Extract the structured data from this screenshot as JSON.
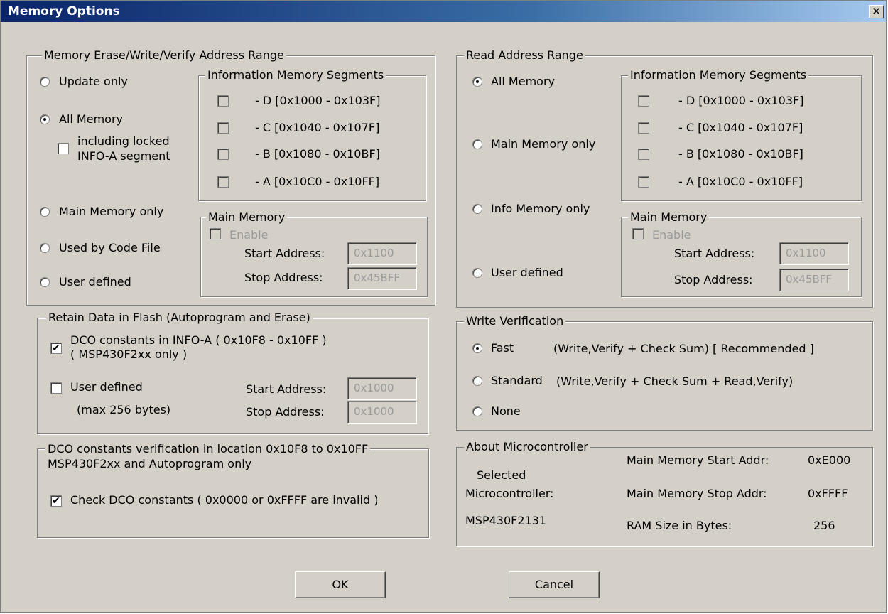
{
  "window": {
    "title": "Memory Options",
    "close_glyph": "✕"
  },
  "erase_range": {
    "legend": "Memory Erase/Write/Verify Address Range",
    "update_only": "Update only",
    "all_memory": "All Memory",
    "locked_line1": "including locked",
    "locked_line2": "INFO-A segment",
    "main_only": "Main Memory only",
    "used_by_code": "Used by Code File",
    "user_defined": "User defined",
    "info_seg": {
      "legend": "Information Memory Segments",
      "d": "- D  [0x1000 - 0x103F]",
      "c": "- C  [0x1040 - 0x107F]",
      "b": "- B  [0x1080 - 0x10BF]",
      "a": "- A  [0x10C0 - 0x10FF]"
    },
    "main_mem": {
      "legend": "Main Memory",
      "enable": "Enable",
      "start_label": "Start Address:",
      "start_value": "0x1100",
      "stop_label": "Stop Address:",
      "stop_value": "0x45BFF"
    }
  },
  "retain": {
    "legend": "Retain Data in Flash   (Autoprogram and Erase)",
    "dco_line1": "DCO constants in INFO-A ( 0x10F8 - 0x10FF )",
    "dco_line2": "( MSP430F2xx only )",
    "user_defined": "User defined",
    "max_bytes": "(max 256 bytes)",
    "start_label": "Start Address:",
    "start_value": "0x1000",
    "stop_label": "Stop Address:",
    "stop_value": "0x1000"
  },
  "dco_verify": {
    "legend": "DCO constants verification in location 0x10F8 to 0x10FF",
    "subtitle": "MSP430F2xx and Autoprogram only",
    "check_label": "Check DCO constants ( 0x0000 or 0xFFFF are invalid )"
  },
  "read_range": {
    "legend": "Read Address Range",
    "all_memory": "All Memory",
    "main_only": "Main Memory only",
    "info_only": "Info Memory only",
    "user_defined": "User defined",
    "info_seg": {
      "legend": "Information Memory Segments",
      "d": "- D  [0x1000 - 0x103F]",
      "c": "- C  [0x1040 - 0x107F]",
      "b": "- B  [0x1080 - 0x10BF]",
      "a": "- A  [0x10C0 - 0x10FF]"
    },
    "main_mem": {
      "legend": "Main Memory",
      "enable": "Enable",
      "start_label": "Start Address:",
      "start_value": "0x1100",
      "stop_label": "Stop Address:",
      "stop_value": "0x45BFF"
    }
  },
  "write_verify": {
    "legend": "Write Verification",
    "fast": "Fast",
    "fast_desc": "(Write,Verify + Check Sum)  [ Recommended ]",
    "standard": "Standard",
    "standard_desc": "(Write,Verify + Check Sum + Read,Verify)",
    "none": "None"
  },
  "about": {
    "legend": "About Microcontroller",
    "selected_line1": "Selected",
    "selected_line2": "Microcontroller:",
    "device": "MSP430F2131",
    "start_label": "Main Memory Start Addr:",
    "start_value": "0xE000",
    "stop_label": "Main Memory Stop Addr:",
    "stop_value": "0xFFFF",
    "ram_label": "RAM Size in Bytes:",
    "ram_value": "256"
  },
  "buttons": {
    "ok": "OK",
    "cancel": "Cancel"
  },
  "icons": {
    "check": "✔"
  }
}
